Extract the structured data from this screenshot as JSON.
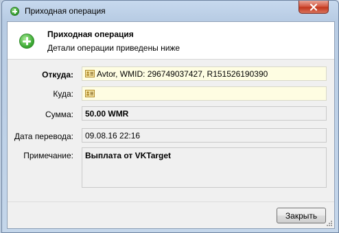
{
  "window": {
    "title": "Приходная операция"
  },
  "header": {
    "title": "Приходная операция",
    "subtitle": "Детали операции приведены ниже"
  },
  "fields": {
    "from_label": "Откуда:",
    "from_value": "Avtor, WMID: 296749037427, R151526190390",
    "to_label": "Куда:",
    "to_value": "",
    "amount_label": "Сумма:",
    "amount_value": "50.00 WMR",
    "date_label": "Дата перевода:",
    "date_value": "09.08.16 22:16",
    "note_label": "Примечание:",
    "note_value": "Выплата от VKTarget"
  },
  "footer": {
    "close_label": "Закрыть"
  },
  "icons": {
    "title": "add-circle-icon",
    "header": "add-circle-icon",
    "contact": "contact-card-icon",
    "close": "close-icon"
  },
  "colors": {
    "accent_green": "#3aa832",
    "close_red": "#c2381f",
    "field_yellow": "#fefde2"
  }
}
